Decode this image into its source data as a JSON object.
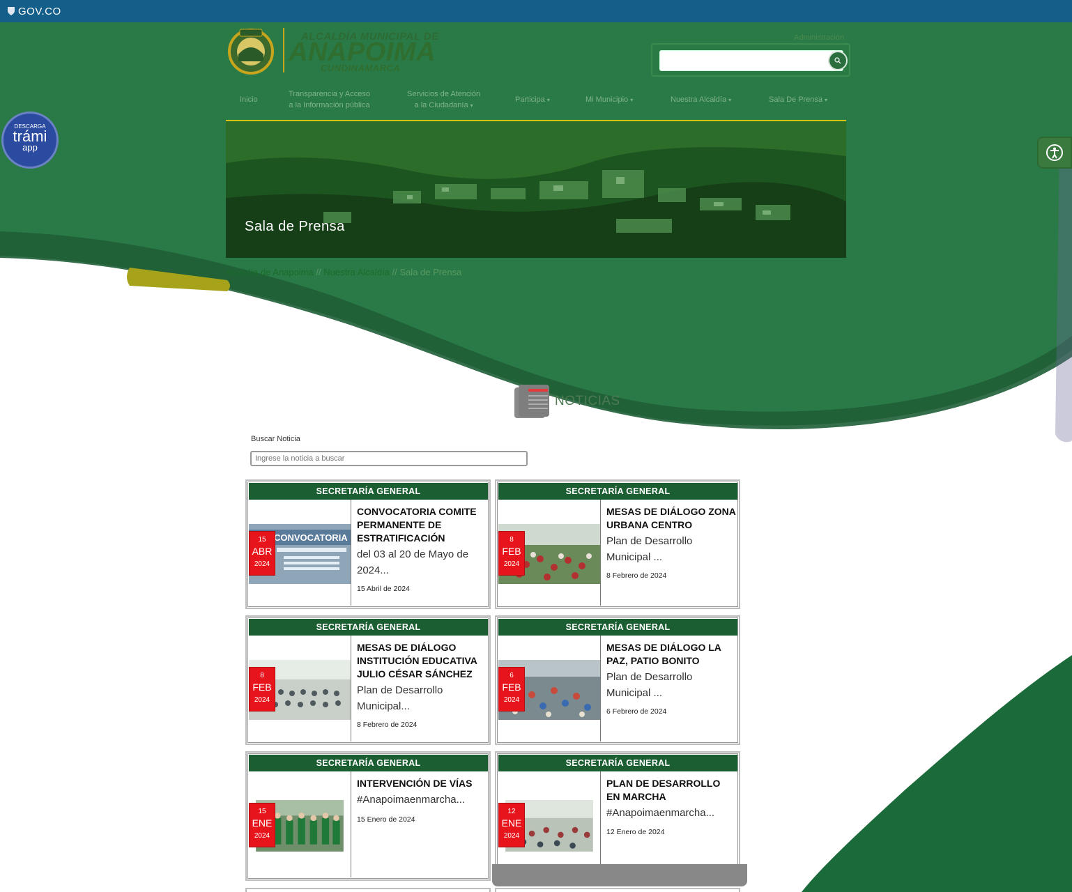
{
  "gov_bar": {
    "label": "GOV.CO"
  },
  "header": {
    "logo_line1": "ALCALDÍA MUNICIPAL DE",
    "logo_line2": "ANAPOIMA",
    "logo_line3": "CUNDINAMARCA",
    "admin_link": "Administración"
  },
  "nav": {
    "items": [
      {
        "line1": "Inicio",
        "line2": ""
      },
      {
        "line1": "Transparencia y Acceso",
        "line2": "a la Información pública"
      },
      {
        "line1": "Servicios de Atención",
        "line2": "a la Ciudadanía"
      },
      {
        "line1": "Participa",
        "line2": ""
      },
      {
        "line1": "Mi Municipio",
        "line2": ""
      },
      {
        "line1": "Nuestra Alcaldía",
        "line2": ""
      },
      {
        "line1": "Sala De Prensa",
        "line2": ""
      }
    ]
  },
  "banner": {
    "title": "Sala de Prensa"
  },
  "breadcrumb": {
    "items": [
      "Alcaldía de Anapoima",
      "Nuestra Alcaldía",
      "Sala de Prensa"
    ],
    "separator": "//"
  },
  "side": {
    "trami_l1": "DESCARGA",
    "trami_l2": "trámi",
    "trami_l3": "app"
  },
  "news": {
    "heading": "NOTICIAS",
    "search_label": "Buscar Noticia",
    "search_placeholder": "Ingrese la noticia a buscar",
    "cards": [
      {
        "category": "SECRETARÍA GENERAL",
        "day": "15",
        "month": "ABR",
        "year": "2024",
        "title": "CONVOCATORIA COMITE PERMANENTE DE ESTRATIFICACIÓN",
        "desc": "del 03 al 20 de Mayo de 2024...",
        "date": "15 Abril de 2024"
      },
      {
        "category": "SECRETARÍA GENERAL",
        "day": "8",
        "month": "FEB",
        "year": "2024",
        "title": "MESAS DE DIÁLOGO ZONA URBANA CENTRO",
        "desc": "Plan de Desarrollo Municipal ...",
        "date": "8 Febrero de 2024"
      },
      {
        "category": "SECRETARÍA GENERAL",
        "day": "8",
        "month": "FEB",
        "year": "2024",
        "title": "MESAS DE DIÁLOGO INSTITUCIÓN EDUCATIVA JULIO CÉSAR SÁNCHEZ",
        "desc": "Plan de Desarrollo Municipal...",
        "date": "8 Febrero de 2024"
      },
      {
        "category": "SECRETARÍA GENERAL",
        "day": "6",
        "month": "FEB",
        "year": "2024",
        "title": "MESAS DE DIÁLOGO LA PAZ, PATIO BONITO",
        "desc": "Plan de Desarrollo Municipal ...",
        "date": "6 Febrero de 2024"
      },
      {
        "category": "SECRETARÍA GENERAL",
        "day": "15",
        "month": "ENE",
        "year": "2024",
        "title": "INTERVENCIÓN DE VÍAS",
        "desc": "#Anapoimaenmarcha...",
        "date": "15 Enero de 2024"
      },
      {
        "category": "SECRETARÍA GENERAL",
        "day": "12",
        "month": "ENE",
        "year": "2024",
        "title": "PLAN DE DESARROLLO EN MARCHA",
        "desc": "#Anapoimaenmarcha...",
        "date": "12 Enero de 2024"
      }
    ],
    "card_photo_text_1": "CONVOCATORIA"
  },
  "colors": {
    "gov_blue": "#145e8a",
    "brand_green": "#2a7a47",
    "dark_green": "#1b5e32",
    "date_red": "#e8141b",
    "nav_underline": "#d6c410"
  }
}
